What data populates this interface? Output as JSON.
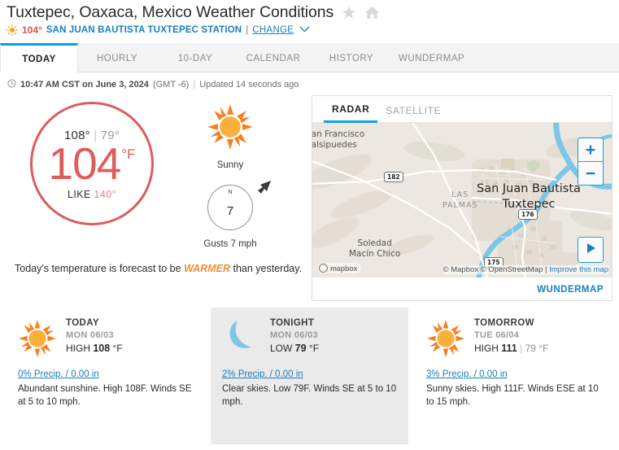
{
  "header": {
    "title": "Tuxtepec, Oaxaca, Mexico Weather Conditions",
    "favorite_icon": "star-icon",
    "home_icon": "home-icon",
    "current_temp": "104°",
    "station_name": "SAN JUAN BAUTISTA TUXTEPEC STATION",
    "separator": "|",
    "change_label": "CHANGE",
    "chevron": "∨"
  },
  "tabs": [
    {
      "label": "TODAY",
      "active": true
    },
    {
      "label": "HOURLY",
      "active": false
    },
    {
      "label": "10-DAY",
      "active": false
    },
    {
      "label": "CALENDAR",
      "active": false
    },
    {
      "label": "HISTORY",
      "active": false
    },
    {
      "label": "WUNDERMAP",
      "active": false
    }
  ],
  "timestamp": {
    "clock_icon": "clock-icon",
    "time": "10:47 AM CST on June 3, 2024",
    "gmt": "(GMT -6)",
    "divider": "|",
    "updated": "Updated 14 seconds ago"
  },
  "current": {
    "high": "108°",
    "divider": "|",
    "low": "79°",
    "temp": "104",
    "unit": "°F",
    "like_label": "LIKE",
    "like_value": "140°",
    "sky_icon": "sun-icon",
    "sky_label": "Sunny",
    "wind_dir_label": "N",
    "wind_speed": "7",
    "gusts": "Gusts 7 mph",
    "forecast_prefix": "Today's temperature is forecast to be",
    "forecast_emphasis": "WARMER",
    "forecast_suffix": "than yesterday.",
    "circle_color": "#de5c5c",
    "emphasis_color": "#f28d30"
  },
  "radar": {
    "tabs": [
      {
        "label": "RADAR",
        "active": true
      },
      {
        "label": "SATELLITE",
        "active": false
      }
    ],
    "map_labels": {
      "san_francisco": "San Francisco",
      "salsipuedes": "Salsipuedes",
      "las": "LAS",
      "palmas": "PALMAS",
      "city_line1": "San Juan Bautista",
      "city_line2": "Tuxtepec",
      "soledad": "Soledad",
      "macin_chico": "Macín Chico",
      "highway_182": "182",
      "highway_175": "175",
      "highway_176": "176"
    },
    "zoom_in": "+",
    "zoom_out": "−",
    "play_icon": "play-icon",
    "mapbox_logo": "mapbox",
    "attribution": "© Mapbox © OpenStreetMap",
    "attribution_divider": "|",
    "improve_link": "Improve this map",
    "wundermap_link": "WUNDERMAP",
    "accent_color": "#14a0d8"
  },
  "forecast_cards": [
    {
      "when": "TODAY",
      "date": "MON 06/03",
      "temp_label": "HIGH",
      "temp_value": "108",
      "temp_unit": "°F",
      "secondary_temp": "",
      "precip": "0% Precip. / 0.00 in",
      "description": "Abundant sunshine. High 108F. Winds SE at 5 to 10 mph.",
      "icon": "sun-icon",
      "shaded": false
    },
    {
      "when": "TONIGHT",
      "date": "MON 06/03",
      "temp_label": "LOW",
      "temp_value": "79",
      "temp_unit": "°F",
      "secondary_temp": "",
      "precip": "2% Precip. / 0.00 in",
      "description": "Clear skies. Low 79F. Winds SE at 5 to 10 mph.",
      "icon": "moon-icon",
      "shaded": true
    },
    {
      "when": "TOMORROW",
      "date": "TUE 06/04",
      "temp_label": "HIGH",
      "temp_value": "111",
      "temp_unit": "°F",
      "secondary_temp": "79",
      "precip": "3% Precip. / 0.00 in",
      "description": "Sunny skies. High 111F. Winds ESE at 10 to 15 mph.",
      "icon": "sun-icon",
      "shaded": false
    }
  ]
}
